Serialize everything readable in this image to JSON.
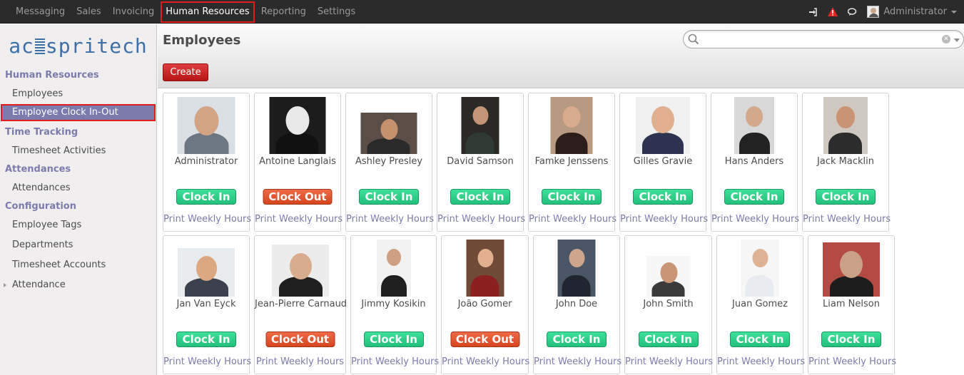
{
  "topbar": {
    "menu": [
      "Messaging",
      "Sales",
      "Invoicing",
      "Human Resources",
      "Reporting",
      "Settings"
    ],
    "active_index": 3,
    "user": "Administrator",
    "icons": [
      "sign-in-icon",
      "alert-icon",
      "chat-icon"
    ]
  },
  "sidebar": {
    "logo": "acespritech",
    "sections": [
      {
        "title": "Human Resources",
        "items": [
          "Employees",
          "Employee Clock In-Out"
        ]
      },
      {
        "title": "Time Tracking",
        "items": [
          "Timesheet Activities"
        ]
      },
      {
        "title": "Attendances",
        "items": [
          "Attendances"
        ]
      },
      {
        "title": "Configuration",
        "items": [
          "Employee Tags",
          "Departments",
          "Timesheet Accounts",
          "Attendance"
        ]
      }
    ],
    "active_item": "Employee Clock In-Out"
  },
  "main": {
    "title": "Employees",
    "create_label": "Create",
    "search_placeholder": "",
    "print_label": "Print Weekly Hours",
    "clock_in_label": "Clock In",
    "clock_out_label": "Clock Out",
    "employees": [
      {
        "name": "Administrator",
        "status": "in"
      },
      {
        "name": "Antoine Langlais",
        "status": "out"
      },
      {
        "name": "Ashley Presley",
        "status": "in"
      },
      {
        "name": "David Samson",
        "status": "in"
      },
      {
        "name": "Famke Jenssens",
        "status": "in"
      },
      {
        "name": "Gilles Gravie",
        "status": "in"
      },
      {
        "name": "Hans Anders",
        "status": "in"
      },
      {
        "name": "Jack Macklin",
        "status": "in"
      },
      {
        "name": "Jan Van Eyck",
        "status": "in"
      },
      {
        "name": "Jean-Pierre Carnaud",
        "status": "out"
      },
      {
        "name": "Jimmy Kosikin",
        "status": "in"
      },
      {
        "name": "João Gomer",
        "status": "out"
      },
      {
        "name": "John Doe",
        "status": "in"
      },
      {
        "name": "John Smith",
        "status": "in"
      },
      {
        "name": "Juan Gomez",
        "status": "in"
      },
      {
        "name": "Liam Nelson",
        "status": "in"
      }
    ]
  },
  "colors": {
    "accent": "#7c7bad",
    "create": "#c52727",
    "clock_in": "#2ecc87",
    "clock_out": "#d9532e",
    "highlight": "#e21c1c"
  }
}
